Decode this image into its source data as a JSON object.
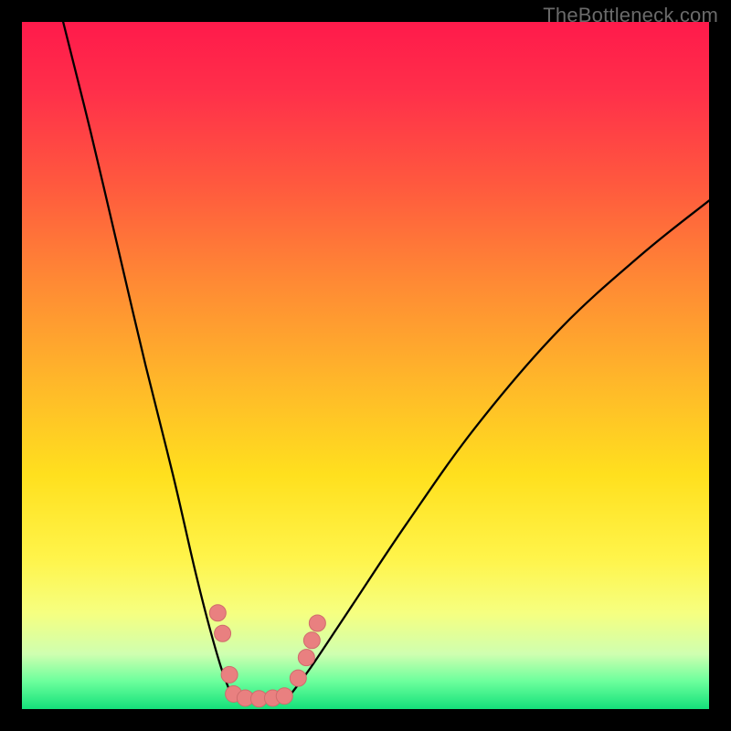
{
  "watermark": "TheBottleneck.com",
  "colors": {
    "frame": "#000000",
    "gradient_top": "#ff1a4b",
    "gradient_bottom": "#14e07a",
    "curve": "#000000",
    "marker_fill": "#e98080",
    "marker_stroke": "#cf6c6c"
  },
  "chart_data": {
    "type": "line",
    "title": "",
    "xlabel": "",
    "ylabel": "",
    "xlim": [
      0,
      100
    ],
    "ylim": [
      0,
      100
    ],
    "notes": "Two unlabeled nonlinear curves descending into a V-shaped minimum near x≈33 with a flat bottom segment, overlaid on a vertical red→green gradient. Salmon-colored circular markers sit along the lower portions of both curves and across the flat trough. Values are read off in 0–100 normalized coordinates (origin bottom-left).",
    "series": [
      {
        "name": "left-curve",
        "x": [
          6,
          10,
          14,
          18,
          22,
          25,
          27,
          29,
          30.5
        ],
        "y": [
          100,
          84,
          67,
          50,
          34,
          21,
          13,
          6,
          2
        ]
      },
      {
        "name": "trough",
        "x": [
          30.5,
          33,
          36,
          39
        ],
        "y": [
          2,
          1.5,
          1.5,
          2
        ]
      },
      {
        "name": "right-curve",
        "x": [
          39,
          42,
          48,
          56,
          66,
          78,
          90,
          100
        ],
        "y": [
          2,
          6,
          15,
          27,
          41,
          55,
          66,
          74
        ]
      }
    ],
    "markers": [
      {
        "x": 28.5,
        "y": 14
      },
      {
        "x": 29.2,
        "y": 11
      },
      {
        "x": 30.2,
        "y": 5
      },
      {
        "x": 30.8,
        "y": 2.2
      },
      {
        "x": 32.5,
        "y": 1.6
      },
      {
        "x": 34.5,
        "y": 1.5
      },
      {
        "x": 36.5,
        "y": 1.6
      },
      {
        "x": 38.2,
        "y": 1.9
      },
      {
        "x": 40.2,
        "y": 4.5
      },
      {
        "x": 41.4,
        "y": 7.5
      },
      {
        "x": 42.2,
        "y": 10
      },
      {
        "x": 43.0,
        "y": 12.5
      }
    ]
  }
}
